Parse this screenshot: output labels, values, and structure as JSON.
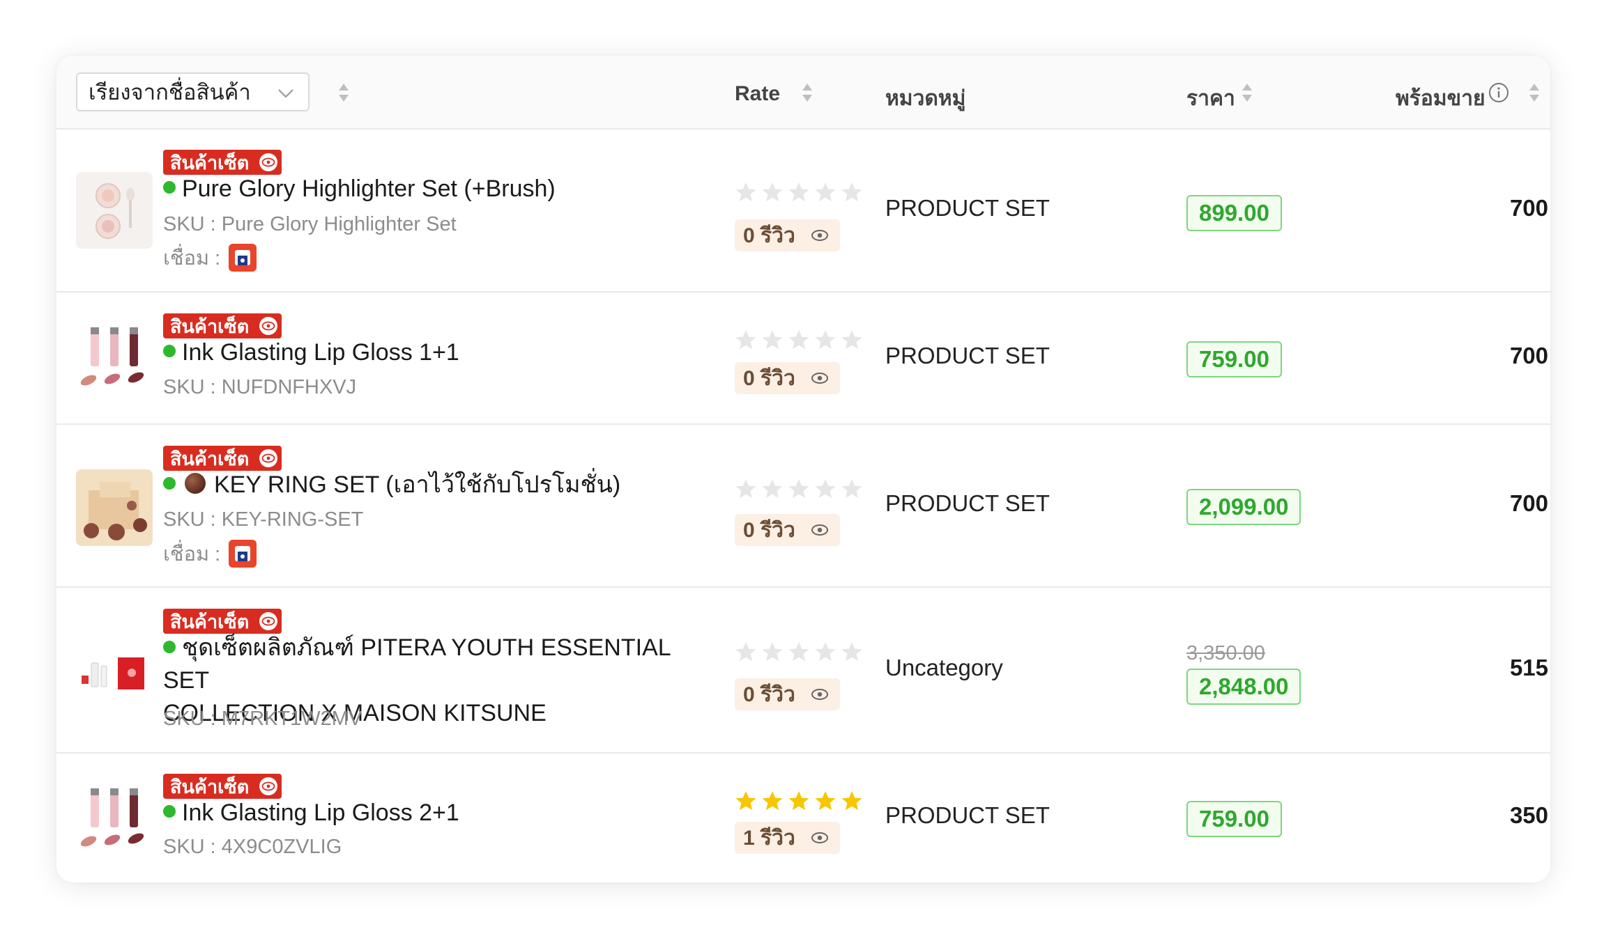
{
  "header": {
    "sort_select": "เรียงจากชื่อสินค้า",
    "rate": "Rate",
    "category": "หมวดหมู่",
    "price": "ราคา",
    "stock": "พร้อมขาย"
  },
  "labels": {
    "set_badge": "สินค้าเซ็ต",
    "link": "เชื่อม :",
    "review_suffix": "รีวิว"
  },
  "products": [
    {
      "name": "Pure Glory Highlighter Set (+Brush)",
      "sku": "SKU : Pure Glory Highlighter Set",
      "linked": true,
      "rating": 0,
      "reviews": "0 รีวิว",
      "category": "PRODUCT SET",
      "price": "899.00",
      "old_price": "",
      "stock": "700",
      "status_color": "#2eb82e"
    },
    {
      "name": "Ink Glasting Lip Gloss 1+1",
      "sku": "SKU : NUFDNFHXVJ",
      "linked": false,
      "rating": 0,
      "reviews": "0 รีวิว",
      "category": "PRODUCT SET",
      "price": "759.00",
      "old_price": "",
      "stock": "700",
      "status_color": "#2eb82e"
    },
    {
      "name": "KEY RING SET (เอาไว้ใช้กับโปรโมชั่น)",
      "sku": "SKU : KEY-RING-SET",
      "linked": true,
      "rating": 0,
      "reviews": "0 รีวิว",
      "category": "PRODUCT SET",
      "price": "2,099.00",
      "old_price": "",
      "stock": "700",
      "status_color": "#2eb82e"
    },
    {
      "name_line1": "ชุดเซ็ตผลิตภัณฑ์ PITERA YOUTH ESSENTIAL SET",
      "name_line2": "COLLECTION X MAISON KITSUNE",
      "sku": "SKU : M7RKT1W2MV",
      "linked": false,
      "rating": 0,
      "reviews": "0 รีวิว",
      "category": "Uncategory",
      "price": "2,848.00",
      "old_price": "3,350.00",
      "stock": "515",
      "status_color": "#2eb82e"
    },
    {
      "name": "Ink Glasting Lip Gloss 2+1",
      "sku": "SKU : 4X9C0ZVLIG",
      "linked": false,
      "rating": 5,
      "reviews": "1 รีวิว",
      "category": "PRODUCT SET",
      "price": "759.00",
      "old_price": "",
      "stock": "350",
      "status_color": "#2eb82e"
    }
  ],
  "colors": {
    "badge": "#d92c20",
    "price_text": "#2ea82e",
    "star_filled": "#f7c600",
    "star_empty": "#e6e6e6",
    "status_dot": "#2eb82e"
  }
}
